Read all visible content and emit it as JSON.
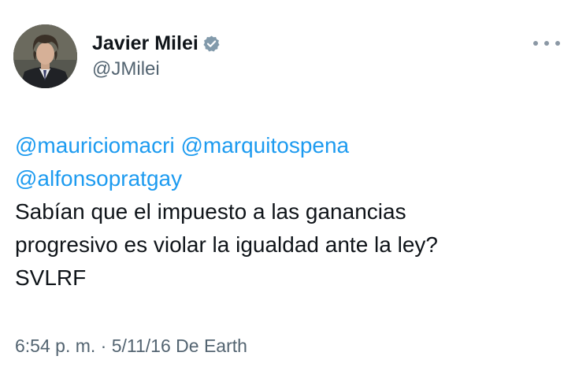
{
  "author": {
    "display_name": "Javier Milei",
    "handle": "@JMilei",
    "verified": true
  },
  "tweet": {
    "mentions": [
      "@mauriciomacri",
      "@marquitospena",
      "@alfonsopratgay"
    ],
    "text_line_1": "Sabían que el impuesto a las ganancias",
    "text_line_2": "progresivo es violar la igualdad ante la ley?",
    "text_line_3": "SVLRF",
    "time": "6:54 p. m.",
    "separator": "·",
    "date": "5/11/16",
    "source": "De Earth"
  },
  "icons": {
    "verified": "verified-badge-icon",
    "more": "more-options-icon"
  },
  "colors": {
    "mention": "#1d9bf0",
    "secondary_text": "#536471",
    "primary_text": "#0f1419",
    "verified_badge": "#829aab"
  }
}
